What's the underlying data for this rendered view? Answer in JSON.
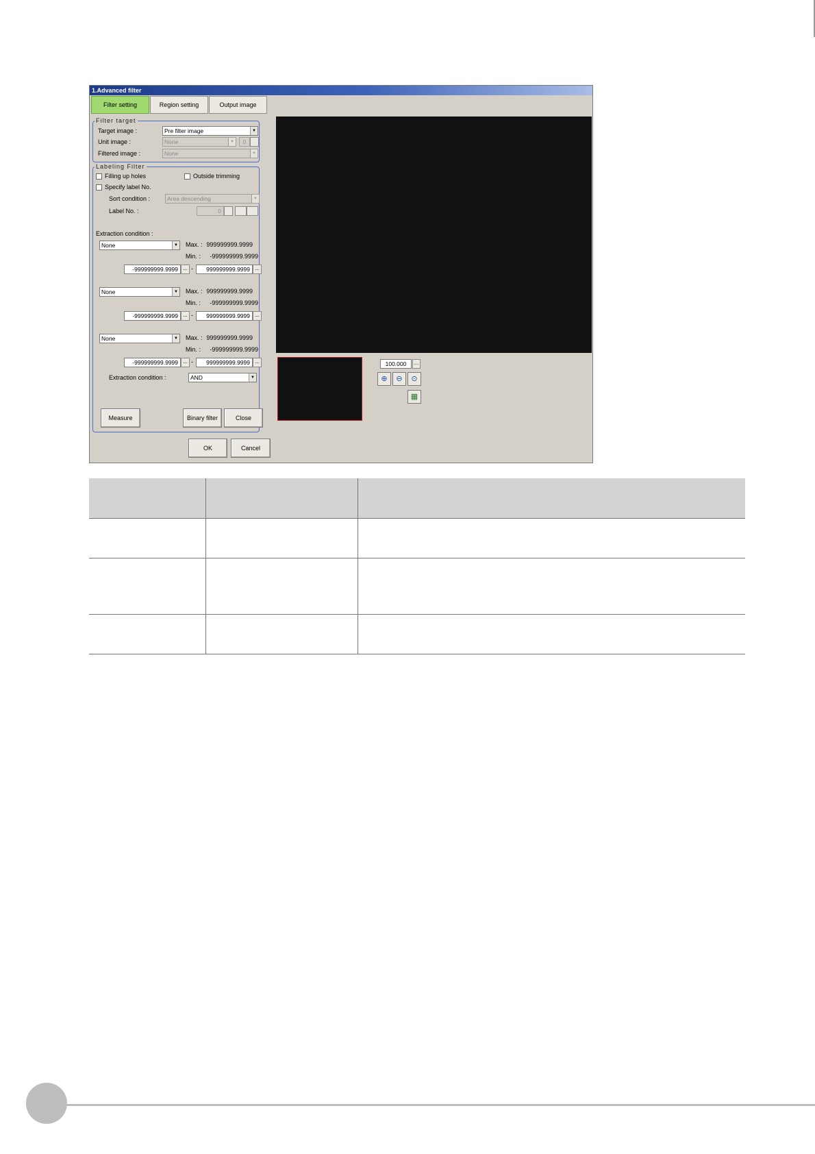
{
  "dialog": {
    "title": "1.Advanced filter",
    "tabs": [
      "Filter setting",
      "Region setting",
      "Output image"
    ],
    "active_tab": "Filter setting"
  },
  "filter_target": {
    "legend": "Filter target",
    "target_image_label": "Target image :",
    "target_image_value": "Pre filter image",
    "unit_image_label": "Unit image :",
    "unit_image_value": "None",
    "unit_image_index": "0",
    "filtered_image_label": "Filtered image :",
    "filtered_image_value": "None"
  },
  "labeling_filter": {
    "legend": "Labeling Filter",
    "filling_up_holes": "Filling up holes",
    "outside_trimming": "Outside trimming",
    "specify_label_no": "Specify label No.",
    "sort_condition_label": "Sort condition :",
    "sort_condition_value": "Area descending",
    "label_no_label": "Label No. :",
    "label_no_value": "0",
    "extraction_condition_heading": "Extraction condition :",
    "conditions": [
      {
        "item": "None",
        "max_label": "Max. :",
        "max_value": "999999999.9999",
        "min_label": "Min. :",
        "min_value": "-999999999.9999",
        "lower": "-999999999.9999",
        "upper": "999999999.9999"
      },
      {
        "item": "None",
        "max_label": "Max. :",
        "max_value": "999999999.9999",
        "min_label": "Min. :",
        "min_value": "-999999999.9999",
        "lower": "-999999999.9999",
        "upper": "999999999.9999"
      },
      {
        "item": "None",
        "max_label": "Max. :",
        "max_value": "999999999.9999",
        "min_label": "Min. :",
        "min_value": "-999999999.9999",
        "lower": "-999999999.9999",
        "upper": "999999999.9999"
      }
    ],
    "range_dash": "-",
    "extraction_logic_label": "Extraction condition :",
    "extraction_logic_value": "AND",
    "measure_button": "Measure",
    "binary_filter_button": "Binary filter",
    "close_button": "Close"
  },
  "footer_buttons": {
    "ok": "OK",
    "cancel": "Cancel"
  },
  "viewer": {
    "zoom_value": "100.000",
    "ellipsis": "...",
    "tools": [
      "zoom-in-icon",
      "zoom-out-icon",
      "zoom-fit-icon",
      "display-switch-icon"
    ]
  },
  "colors": {
    "active_tab": "#9fd96f",
    "group_border": "#4a6fc9",
    "image_background": "#111111",
    "table_header": "#d3d3d3"
  }
}
